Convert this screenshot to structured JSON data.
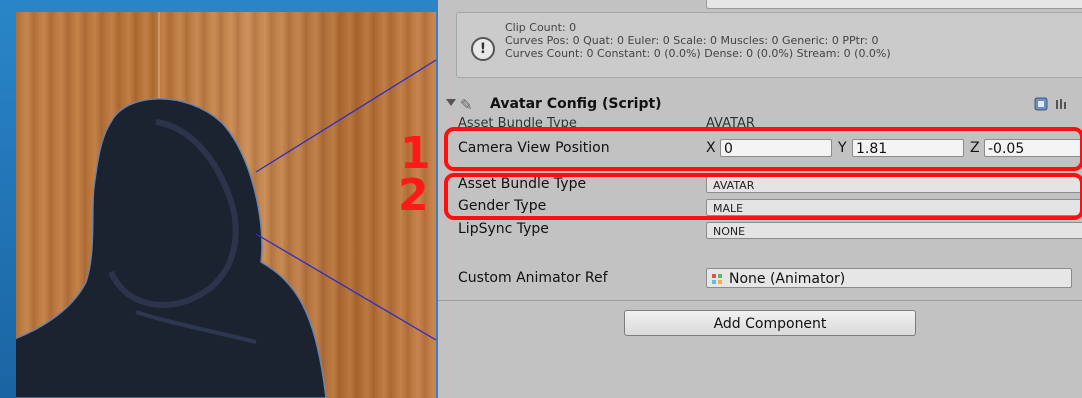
{
  "info": {
    "clip_count": "Clip Count: 0",
    "curves_pos": "Curves Pos: 0 Quat: 0 Euler: 0 Scale: 0 Muscles: 0 Generic: 0 PPtr: 0",
    "curves_count": "Curves Count: 0 Constant: 0 (0.0%) Dense: 0 (0.0%) Stream: 0 (0.0%)"
  },
  "component": {
    "title": "Avatar Config (Script)",
    "ghost_label": "Asset Bundle Type",
    "ghost_value": "AVATAR"
  },
  "camera_view": {
    "label": "Camera View Position",
    "x_label": "X",
    "x_value": "0",
    "y_label": "Y",
    "y_value": "1.81",
    "z_label": "Z",
    "z_value": "-0.05"
  },
  "fields": {
    "asset_bundle_label": "Asset Bundle Type",
    "asset_bundle_value": "AVATAR",
    "gender_label": "Gender Type",
    "gender_value": "MALE",
    "lipsync_label": "LipSync Type",
    "lipsync_value": "NONE",
    "animator_label": "Custom Animator Ref",
    "animator_value": "None (Animator)"
  },
  "add_component_label": "Add Component",
  "annotations": {
    "one": "1",
    "two": "2"
  },
  "colors": {
    "highlight": "#ff0f0f",
    "frame": "#1f6fae",
    "panel": "#c2c2c2"
  },
  "icons": [
    "info-icon",
    "script-icon",
    "help-icon",
    "settings-icon",
    "animator-icon",
    "fold-triangle-icon"
  ]
}
